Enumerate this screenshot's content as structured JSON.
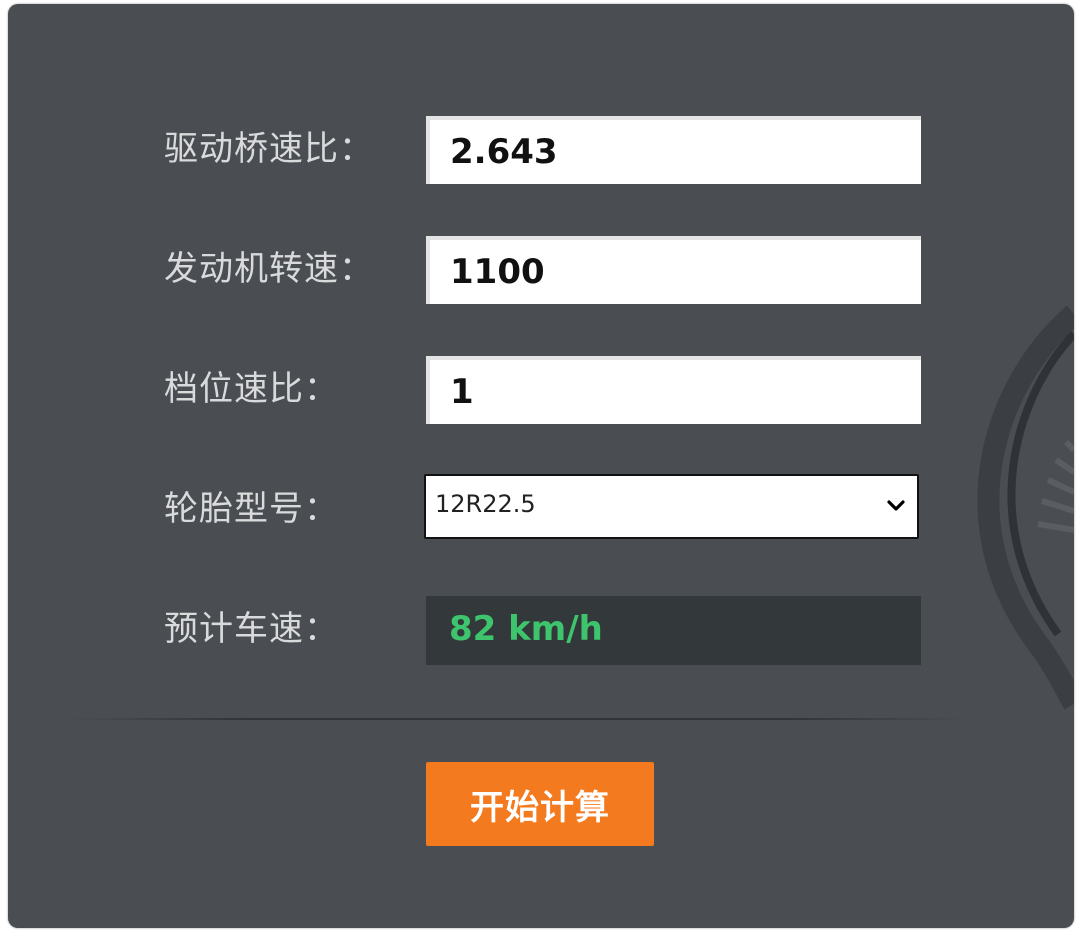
{
  "form": {
    "axle_ratio": {
      "label": "驱动桥速比：",
      "value": "2.643"
    },
    "engine_speed": {
      "label": "发动机转速：",
      "value": "1100"
    },
    "gear_ratio": {
      "label": "档位速比：",
      "value": "1"
    },
    "tire_model": {
      "label": "轮胎型号：",
      "selected": "12R22.5",
      "icon": "chevron-down-icon"
    },
    "estimated_speed": {
      "label": "预计车速：",
      "value": "82 km/h"
    }
  },
  "actions": {
    "calculate_label": "开始计算"
  },
  "colors": {
    "panel_bg": "#4a4d52",
    "label_text": "#d9dadb",
    "result_bg": "#33383a",
    "result_text": "#3ec46d",
    "button_bg": "#f47a1f",
    "button_text": "#ffffff"
  },
  "decorations": {
    "background_icon": "speedometer-gauge-icon"
  }
}
